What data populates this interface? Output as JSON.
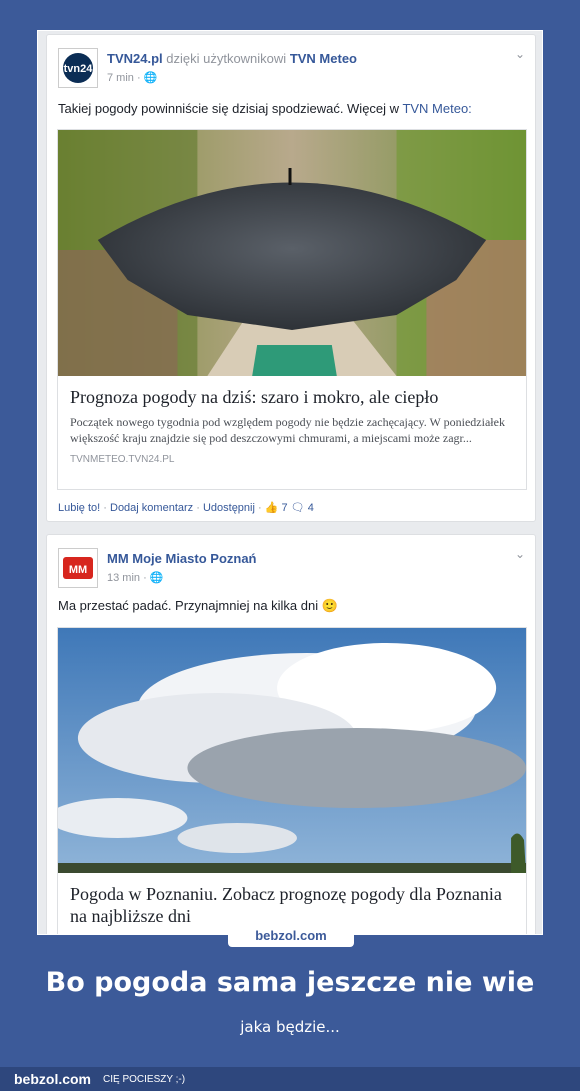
{
  "posts": [
    {
      "author": "TVN24.pl",
      "via": "dzięki użytkownikowi",
      "page": "TVN Meteo",
      "time": "7 min",
      "text": "Takiej pogody powinniście się dzisiaj spodziewać. Więcej w",
      "text_link": "TVN Meteo:",
      "card_title": "Prognoza pogody na dziś: szaro i mokro, ale ciepło",
      "card_desc": "Początek nowego tygodnia pod względem pogody nie będzie zachęcający. W poniedziałek większość kraju znajdzie się pod deszczowymi chmurami, a miejscami może zagr...",
      "card_source": "TVNMETEO.TVN24.PL",
      "actions": {
        "like": "Lubię to!",
        "comment": "Dodaj komentarz",
        "share": "Udostępnij",
        "likes": "7",
        "comments": "4"
      }
    },
    {
      "author": "MM Moje Miasto Poznań",
      "time": "13 min",
      "text": "Ma przestać padać. Przynajmniej na kilka dni",
      "card_title": "Pogoda w Poznaniu. Zobacz prognozę pogody dla Poznania na najbliższe dni"
    }
  ],
  "site_badge": "bebzol.com",
  "headline": "Bo pogoda sama jeszcze nie wie",
  "subline": "jaka będzie...",
  "footer": {
    "brand": "bebzol.com",
    "tagline": "CIĘ POCIESZY ;-)"
  },
  "colors": {
    "background": "#3c5a99",
    "link": "#365899"
  }
}
